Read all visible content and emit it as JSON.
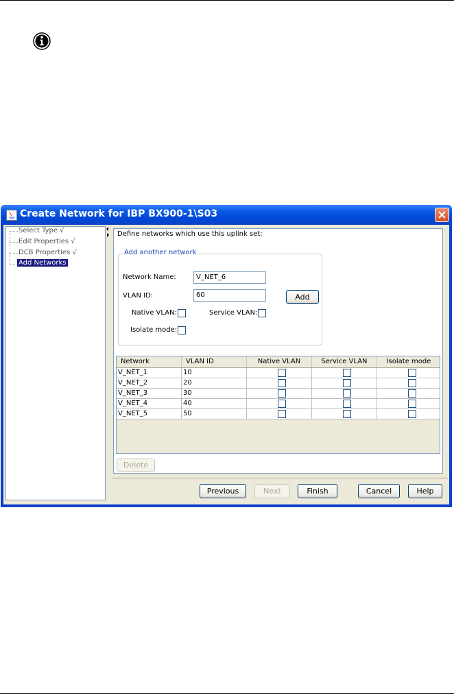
{
  "dialog": {
    "title": "Create Network for IBP BX900-1\\S03"
  },
  "steps": [
    {
      "label": "Select Type √"
    },
    {
      "label": "Edit Properties √"
    },
    {
      "label": "DCB Properties √"
    },
    {
      "label": "Add Networks"
    }
  ],
  "panel": {
    "instruction": "Define networks which use this uplink set:",
    "group_title": "Add another network",
    "network_name_label": "Network Name:",
    "network_name_value": "V_NET_6",
    "vlan_id_label": "VLAN ID:",
    "vlan_id_value": "60",
    "add_label": "Add",
    "native_vlan_label": "Native VLAN:",
    "service_vlan_label": "Service VLAN:",
    "isolate_mode_label": "Isolate mode:"
  },
  "table": {
    "columns": [
      "Network",
      "VLAN ID",
      "Native VLAN",
      "Service VLAN",
      "Isolate mode"
    ],
    "rows": [
      {
        "network": "V_NET_1",
        "vlan": "10"
      },
      {
        "network": "V_NET_2",
        "vlan": "20"
      },
      {
        "network": "V_NET_3",
        "vlan": "30"
      },
      {
        "network": "V_NET_4",
        "vlan": "40"
      },
      {
        "network": "V_NET_5",
        "vlan": "50"
      }
    ]
  },
  "buttons": {
    "delete": "Delete",
    "previous": "Previous",
    "next": "Next",
    "finish": "Finish",
    "cancel": "Cancel",
    "help": "Help"
  },
  "icons": {
    "info": "info-icon",
    "close": "close-icon",
    "app": "java-app-icon"
  }
}
